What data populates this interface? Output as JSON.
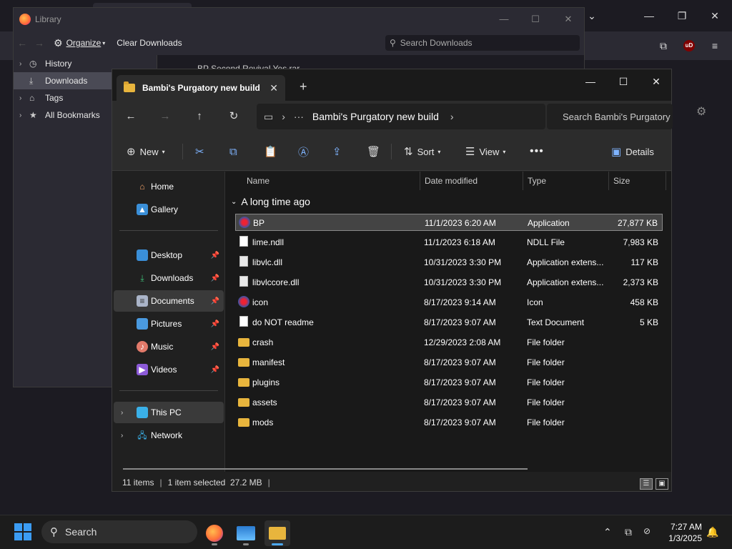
{
  "library": {
    "title": "Library",
    "organize": "Organize",
    "clear_downloads": "Clear Downloads",
    "search_placeholder": "Search Downloads",
    "sidebar": [
      {
        "label": "History"
      },
      {
        "label": "Downloads"
      },
      {
        "label": "Tags"
      },
      {
        "label": "All Bookmarks"
      }
    ],
    "download_item": "BP Second Revival Yes.rar"
  },
  "explorer": {
    "tab_title": "Bambi's Purgatory new build",
    "path_current": "Bambi's Purgatory new build",
    "search_placeholder": "Search Bambi's Purgatory",
    "commands": {
      "new": "New",
      "sort": "Sort",
      "view": "View",
      "details": "Details"
    },
    "nav": {
      "home": "Home",
      "gallery": "Gallery",
      "desktop": "Desktop",
      "downloads": "Downloads",
      "documents": "Documents",
      "pictures": "Pictures",
      "music": "Music",
      "videos": "Videos",
      "this_pc": "This PC",
      "network": "Network"
    },
    "columns": {
      "name": "Name",
      "date": "Date modified",
      "type": "Type",
      "size": "Size"
    },
    "group": "A long time ago",
    "files": [
      {
        "name": "BP",
        "date": "11/1/2023 6:20 AM",
        "type": "Application",
        "size": "27,877 KB",
        "icon": "app"
      },
      {
        "name": "lime.ndll",
        "date": "11/1/2023 6:18 AM",
        "type": "NDLL File",
        "size": "7,983 KB",
        "icon": "doc"
      },
      {
        "name": "libvlc.dll",
        "date": "10/31/2023 3:30 PM",
        "type": "Application extens...",
        "size": "117 KB",
        "icon": "dll"
      },
      {
        "name": "libvlccore.dll",
        "date": "10/31/2023 3:30 PM",
        "type": "Application extens...",
        "size": "2,373 KB",
        "icon": "dll"
      },
      {
        "name": "icon",
        "date": "8/17/2023 9:14 AM",
        "type": "Icon",
        "size": "458 KB",
        "icon": "app"
      },
      {
        "name": "do NOT readme",
        "date": "8/17/2023 9:07 AM",
        "type": "Text Document",
        "size": "5 KB",
        "icon": "doc"
      },
      {
        "name": "crash",
        "date": "12/29/2023 2:08 AM",
        "type": "File folder",
        "size": "",
        "icon": "folder"
      },
      {
        "name": "manifest",
        "date": "8/17/2023 9:07 AM",
        "type": "File folder",
        "size": "",
        "icon": "folder"
      },
      {
        "name": "plugins",
        "date": "8/17/2023 9:07 AM",
        "type": "File folder",
        "size": "",
        "icon": "folder"
      },
      {
        "name": "assets",
        "date": "8/17/2023 9:07 AM",
        "type": "File folder",
        "size": "",
        "icon": "folder"
      },
      {
        "name": "mods",
        "date": "8/17/2023 9:07 AM",
        "type": "File folder",
        "size": "",
        "icon": "folder"
      }
    ],
    "status": {
      "count": "11 items",
      "selected": "1 item selected  27.2 MB"
    }
  },
  "taskbar": {
    "search": "Search",
    "time": "7:27 AM",
    "date": "1/3/2025"
  },
  "ublock_label": "uD"
}
